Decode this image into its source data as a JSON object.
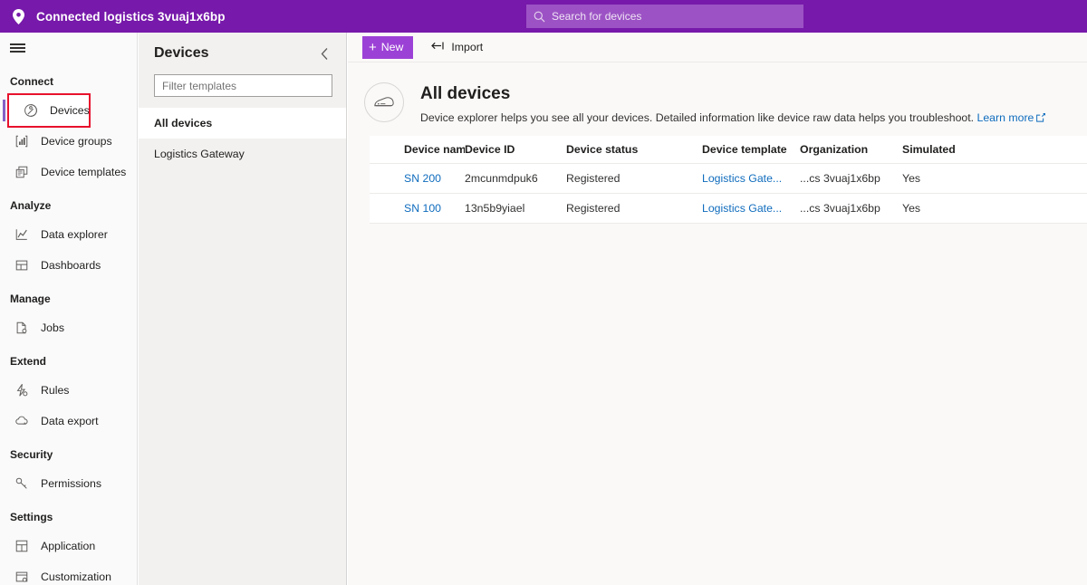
{
  "topbar": {
    "app_title": "Connected logistics 3vuaj1x6bp",
    "pin_icon": "location-pin-icon",
    "search_placeholder": "Search for devices",
    "search_icon": "search-icon",
    "background_color": "#7719aa",
    "search_background_color": "#9c52c4"
  },
  "sidebar": {
    "menu_icon": "hamburger-menu-icon",
    "groups": [
      {
        "label": "Connect",
        "items": [
          {
            "label": "Devices",
            "icon": "devices-icon",
            "selected": true,
            "highlighted": true
          },
          {
            "label": "Device groups",
            "icon": "device-groups-icon",
            "selected": false,
            "highlighted": false
          },
          {
            "label": "Device templates",
            "icon": "device-templates-icon",
            "selected": false,
            "highlighted": false
          }
        ]
      },
      {
        "label": "Analyze",
        "items": [
          {
            "label": "Data explorer",
            "icon": "line-chart-icon",
            "selected": false,
            "highlighted": false
          },
          {
            "label": "Dashboards",
            "icon": "dashboard-grid-icon",
            "selected": false,
            "highlighted": false
          }
        ]
      },
      {
        "label": "Manage",
        "items": [
          {
            "label": "Jobs",
            "icon": "jobs-icon",
            "selected": false,
            "highlighted": false
          }
        ]
      },
      {
        "label": "Extend",
        "items": [
          {
            "label": "Rules",
            "icon": "rules-icon",
            "selected": false,
            "highlighted": false
          },
          {
            "label": "Data export",
            "icon": "cloud-export-icon",
            "selected": false,
            "highlighted": false
          }
        ]
      },
      {
        "label": "Security",
        "items": [
          {
            "label": "Permissions",
            "icon": "key-icon",
            "selected": false,
            "highlighted": false
          }
        ]
      },
      {
        "label": "Settings",
        "items": [
          {
            "label": "Application",
            "icon": "application-icon",
            "selected": false,
            "highlighted": false
          },
          {
            "label": "Customization",
            "icon": "customization-icon",
            "selected": false,
            "highlighted": false
          }
        ]
      }
    ],
    "highlight_color": "#e8112d",
    "selection_indicator_color": "#8661c5"
  },
  "panel": {
    "title": "Devices",
    "collapse_icon": "chevron-left-icon",
    "filter_placeholder": "Filter templates",
    "filter_value": "",
    "items": [
      {
        "label": "All devices",
        "selected": true
      },
      {
        "label": "Logistics Gateway",
        "selected": false
      }
    ]
  },
  "toolbar": {
    "new_label": "New",
    "new_icon": "plus-icon",
    "new_color": "#9c41d6",
    "import_label": "Import",
    "import_icon": "import-arrow-icon"
  },
  "page": {
    "avatar_icon": "device-hardware-icon",
    "title": "All devices",
    "description": "Device explorer helps you see all your devices. Detailed information like device raw data helps you troubleshoot.",
    "learn_more": "Learn more",
    "learn_more_icon": "external-link-icon",
    "link_color": "#0f6cbd"
  },
  "table": {
    "columns": [
      "Device name",
      "Device ID",
      "Device status",
      "Device template",
      "Organization",
      "Simulated"
    ],
    "rows": [
      {
        "device_name": "SN 200",
        "device_id": "2mcunmdpuk6",
        "device_status": "Registered",
        "device_template": "Logistics Gate...",
        "organization": "...cs 3vuaj1x6bp",
        "simulated": "Yes"
      },
      {
        "device_name": "SN 100",
        "device_id": "13n5b9yiael",
        "device_status": "Registered",
        "device_template": "Logistics Gate...",
        "organization": "...cs 3vuaj1x6bp",
        "simulated": "Yes"
      }
    ]
  }
}
